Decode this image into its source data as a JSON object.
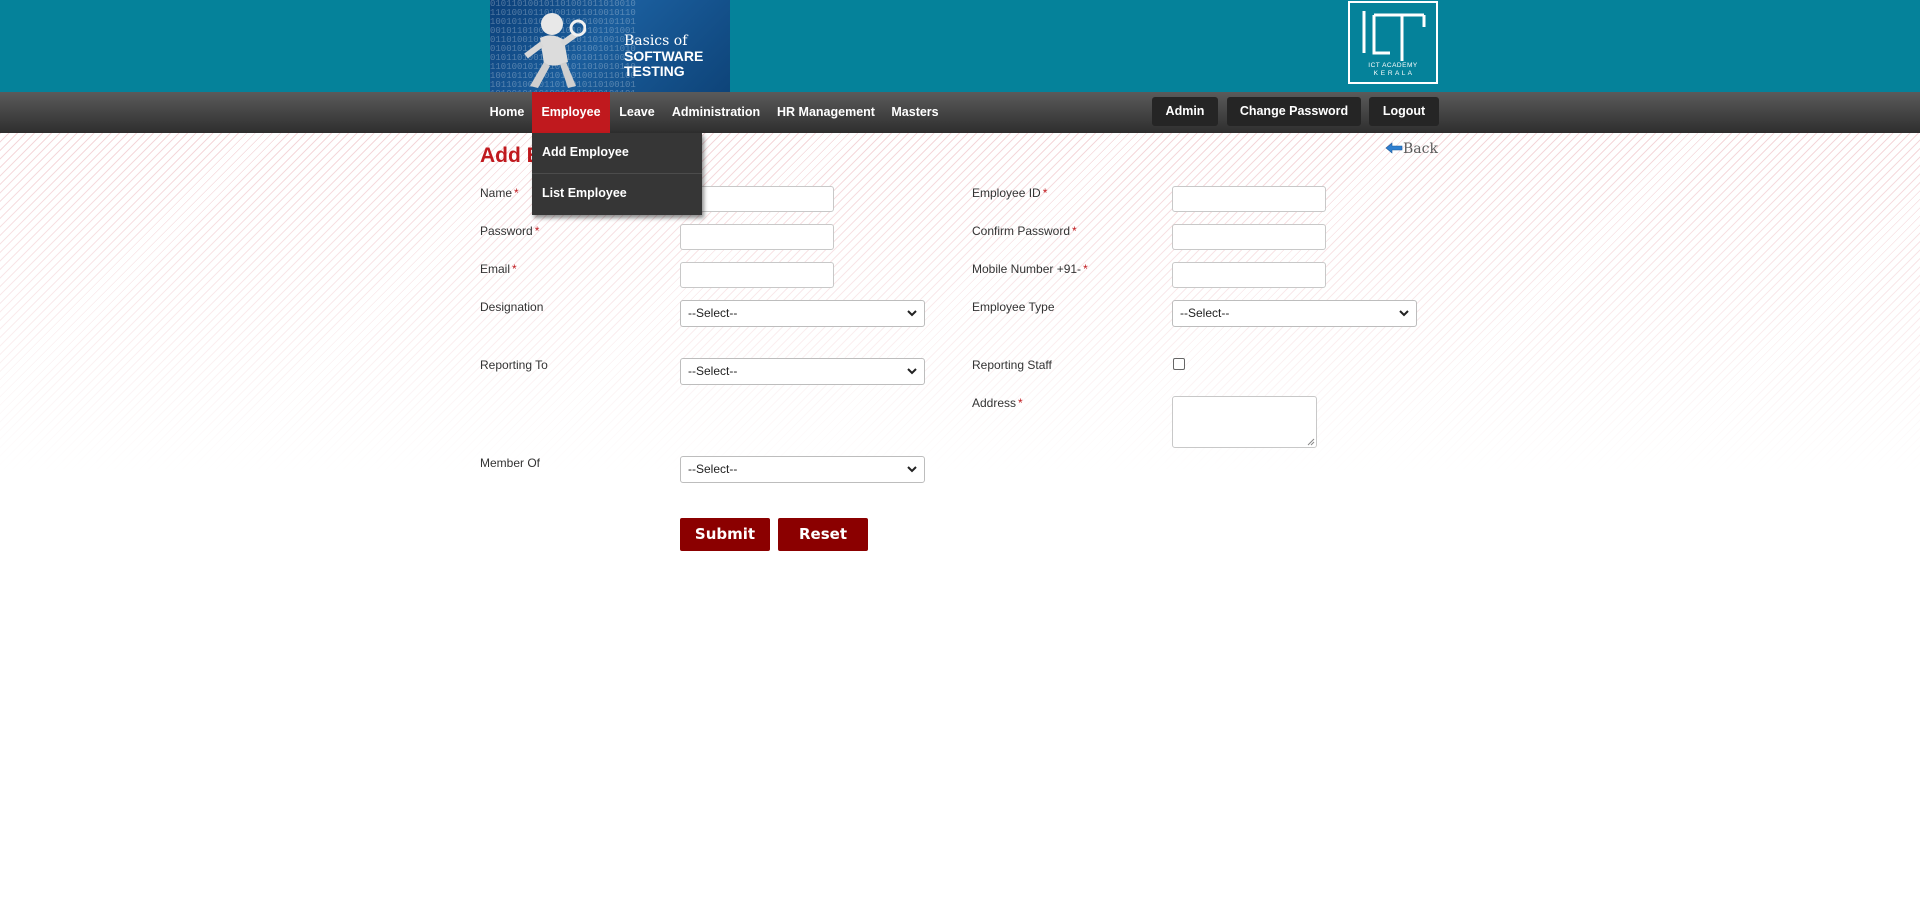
{
  "header": {
    "logo_left": {
      "line1": "Basics of",
      "line2": "SOFTWARE",
      "line3": "TESTING"
    },
    "logo_right": {
      "line1": "ICT ACADEMY",
      "line2": "K E R A L A"
    }
  },
  "nav": {
    "items": [
      {
        "label": "Home"
      },
      {
        "label": "Employee",
        "active": true
      },
      {
        "label": "Leave"
      },
      {
        "label": "Administration"
      },
      {
        "label": "HR Management"
      },
      {
        "label": "Masters"
      }
    ],
    "right_buttons": [
      {
        "label": "Admin"
      },
      {
        "label": "Change Password"
      },
      {
        "label": "Logout"
      }
    ]
  },
  "dropdown": {
    "items": [
      {
        "label": "Add Employee"
      },
      {
        "label": "List Employee"
      }
    ]
  },
  "page": {
    "title": "Add Employee",
    "back_label": "Back"
  },
  "form": {
    "left": {
      "name_label": "Name",
      "password_label": "Password",
      "email_label": "Email",
      "designation_label": "Designation",
      "designation_value": "--Select--",
      "reporting_to_label": "Reporting To",
      "reporting_to_value": "--Select--",
      "member_of_label": "Member Of",
      "member_of_value": "--Select--"
    },
    "right": {
      "employee_id_label": "Employee ID",
      "confirm_password_label": "Confirm Password",
      "mobile_label": "Mobile Number +91-",
      "employee_type_label": "Employee Type",
      "employee_type_value": "--Select--",
      "reporting_staff_label": "Reporting Staff",
      "address_label": "Address"
    },
    "required_mark": "*",
    "submit_label": "Submit",
    "reset_label": "Reset"
  },
  "colors": {
    "header_bg": "#05829a",
    "accent_red": "#c0191e",
    "button_red": "#8b0000",
    "nav_bg": "#3a3a3a"
  }
}
